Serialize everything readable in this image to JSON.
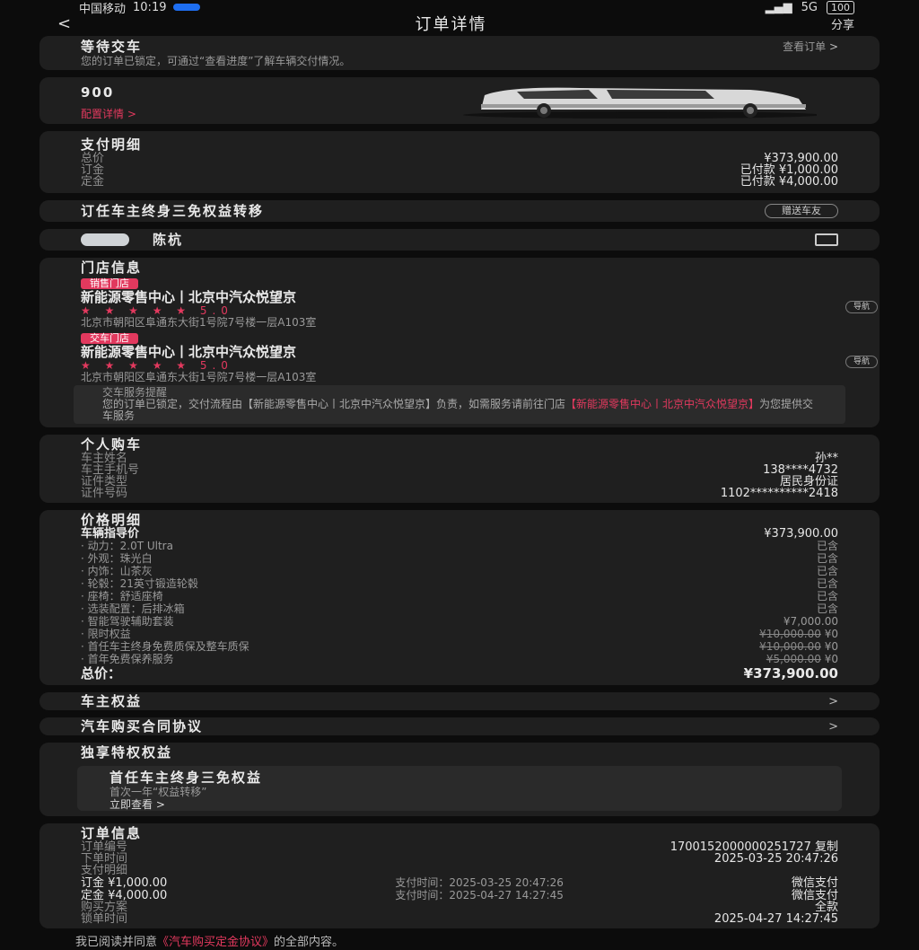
{
  "status_bar": {
    "carrier": "中国移动",
    "time": "10:19",
    "signal": "5G",
    "battery": "100"
  },
  "nav": {
    "back": "<",
    "title": "订单详情",
    "share": "分享"
  },
  "order_status": {
    "title": "等待交车",
    "action": "查看订单",
    "desc": "您的订单已锁定，可通过“查看进度”了解车辆交付情况。"
  },
  "car": {
    "model": "900",
    "config_link": "配置详情 >"
  },
  "payment": {
    "title": "支付明细",
    "rows": [
      {
        "label": "总价",
        "value": "¥373,900.00"
      },
      {
        "label": "订金",
        "value": "已付款 ¥1,000.00"
      },
      {
        "label": "定金",
        "value": "已付款 ¥4,000.00"
      }
    ]
  },
  "gift": {
    "text": "订任车主终身三免权益转移",
    "button": "赠送车友"
  },
  "advisor": {
    "name": "陈杭"
  },
  "store": {
    "title": "门店信息",
    "items": [
      {
        "tag": "销售门店",
        "name": "新能源零售中心丨北京中汽众悦望京",
        "stars": "★ ★ ★ ★ ★ 5.0",
        "address": "北京市朝阳区阜通东大街1号院7号楼一层A103室",
        "loc_btn": "导航"
      },
      {
        "tag": "交车门店",
        "name": "新能源零售中心丨北京中汽众悦望京",
        "stars": "★ ★ ★ ★ ★ 5.0",
        "address": "北京市朝阳区阜通东大街1号院7号楼一层A103室",
        "loc_btn": "导航"
      }
    ],
    "notice_title": "交车服务提醒",
    "notice_text": "您的订单已锁定，交付流程由【新能源零售中心丨北京中汽众悦望京】负责，如需服务请前往门店",
    "notice_link": "【新能源零售中心丨北京中汽众悦望京】",
    "notice_tail": "为您提供交车服务"
  },
  "buyer": {
    "title": "个人购车",
    "rows": [
      {
        "label": "车主姓名",
        "value": "孙**"
      },
      {
        "label": "车主手机号",
        "value": "138****4732"
      },
      {
        "label": "证件类型",
        "value": "居民身份证"
      },
      {
        "label": "证件号码",
        "value": "1102**********2418"
      }
    ]
  },
  "price": {
    "title": "价格明细",
    "base_label": "车辆指导价",
    "base_value": "¥373,900.00",
    "items": [
      {
        "label": "· 动力：2.0T Ultra",
        "value": "已含"
      },
      {
        "label": "· 外观：珠光白",
        "value": "已含"
      },
      {
        "label": "· 内饰：山茶灰",
        "value": "已含"
      },
      {
        "label": "· 轮毂：21英寸锻造轮毂",
        "value": "已含"
      },
      {
        "label": "· 座椅：舒适座椅",
        "value": "已含"
      },
      {
        "label": "· 选装配置：后排冰箱",
        "value": "已含"
      },
      {
        "label": "· 智能驾驶辅助套装",
        "value": "¥7,000.00"
      }
    ],
    "discounts": [
      {
        "label": "· 限时权益",
        "orig": "¥10,000.00",
        "value": "¥0"
      },
      {
        "label": "· 首任车主终身免费质保及整车质保",
        "orig": "¥10,000.00",
        "value": "¥0"
      },
      {
        "label": "· 首年免费保养服务",
        "orig": "¥5,000.00",
        "value": "¥0"
      }
    ],
    "total_label": "总价：",
    "total_value": "¥373,900.00"
  },
  "links": [
    {
      "text": "车主权益",
      "chevron": ">"
    },
    {
      "text": "汽车购买合同协议",
      "chevron": ">"
    }
  ],
  "perks": {
    "title": "独享特权权益",
    "box_title": "首任车主终身三免权益",
    "box_sub": "首次一年“权益转移”",
    "box_link": "立即查看 >"
  },
  "order_info": {
    "title": "订单信息",
    "rows": [
      {
        "label": "订单编号",
        "mid": "",
        "value": "1700152000000251727  复制"
      },
      {
        "label": "下单时间",
        "mid": "",
        "value": "2025-03-25 20:47:26"
      },
      {
        "label": "支付明细",
        "mid": "",
        "value": ""
      },
      {
        "label": "订金 ¥1,000.00",
        "mid": "支付时间：2025-03-25 20:47:26",
        "value": "微信支付"
      },
      {
        "label": "定金 ¥4,000.00",
        "mid": "支付时间：2025-04-27 14:27:45",
        "value": "微信支付"
      },
      {
        "label": "购买方案",
        "mid": "",
        "value": "全款"
      },
      {
        "label": "锁单时间",
        "mid": "",
        "value": "2025-04-27 14:27:45"
      }
    ]
  },
  "footer": {
    "pre": "我已阅读并同意",
    "link": "《汽车购买定金协议》",
    "post": "的全部内容。"
  }
}
